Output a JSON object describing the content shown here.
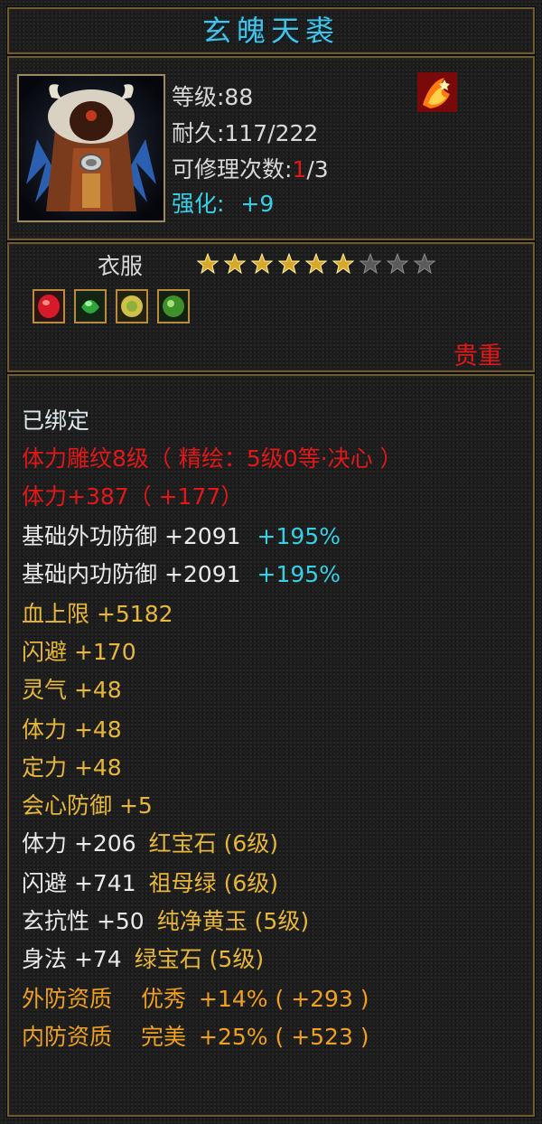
{
  "item": {
    "name": "玄魄天裘",
    "level_label": "等级:88",
    "durability_label": "耐久:117/222",
    "repair_prefix": "可修理次数:",
    "repair_used": "1",
    "repair_total": "/3",
    "enhance_label": "强化:",
    "enhance_value": "+9",
    "category": "衣服",
    "stars_total": 9,
    "stars_filled": 6,
    "rarity": "贵重"
  },
  "gems": [
    "red-gem",
    "green-gem",
    "yellow-gem",
    "jade-gem"
  ],
  "attributes": {
    "bound": "已绑定",
    "engrave": "体力雕纹8级（ 精绘：5级0等·决心 ）",
    "stamina_main": "体力+387（ +177）",
    "ext_def_label": "基础外功防御 +2091",
    "ext_def_pct": "+195%",
    "int_def_label": "基础内功防御 +2091",
    "int_def_pct": "+195%",
    "hp": "血上限 +5182",
    "dodge": "闪避 +170",
    "spirit": "灵气 +48",
    "stamina": "体力 +48",
    "focus": "定力 +48",
    "crit_def": "会心防御 +5",
    "gem1_stat": "体力 +206",
    "gem1_name": "红宝石 (6级)",
    "gem2_stat": "闪避 +741",
    "gem2_name": "祖母绿 (6级)",
    "gem3_stat": "玄抗性 +50",
    "gem3_name": "纯净黄玉 (5级)",
    "gem4_stat": "身法 +74",
    "gem4_name": "绿宝石 (5级)",
    "ext_quality_label": "外防资质",
    "ext_quality_grade": "优秀",
    "ext_quality_value": "+14% ( +293 )",
    "int_quality_label": "内防资质",
    "int_quality_grade": "完美",
    "int_quality_value": "+25% ( +523 )"
  },
  "colors": {
    "title": "#47c2e6",
    "red": "#e01818",
    "cyan": "#35d0e6",
    "gold": "#e7b73a",
    "frame": "#6b5a34"
  }
}
